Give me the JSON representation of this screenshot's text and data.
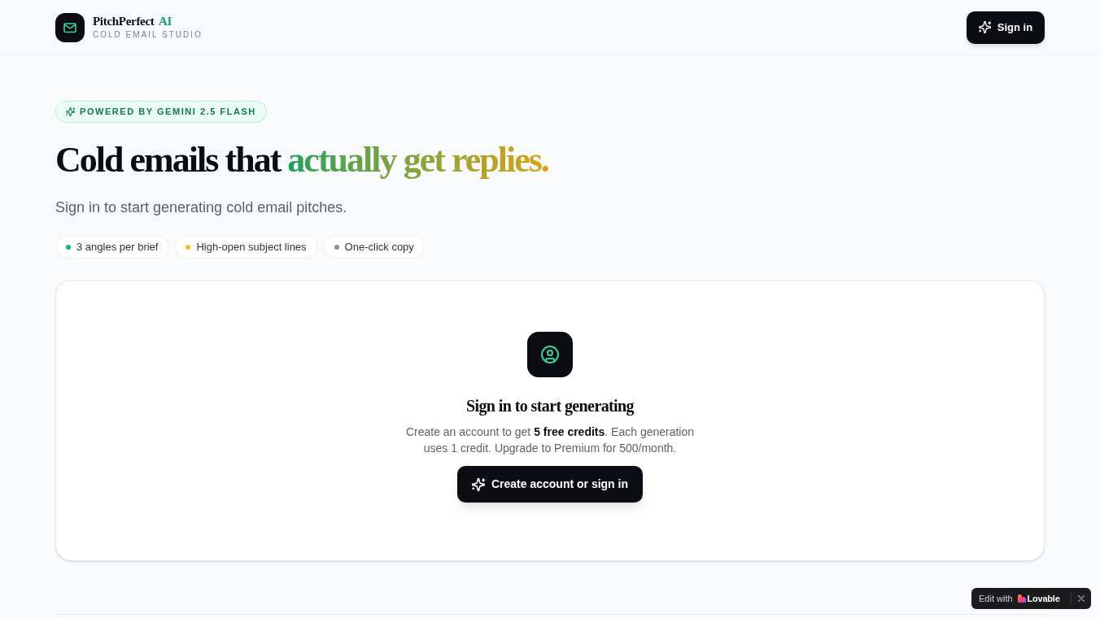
{
  "header": {
    "logo": {
      "name": "PitchPerfect",
      "accent": "AI",
      "tagline": "COLD EMAIL STUDIO"
    },
    "sign_in_button": "Sign in"
  },
  "hero": {
    "badge": "POWERED BY GEMINI 2.5 FLASH",
    "headline": {
      "text": "Cold emails that",
      "highlight": "actually get replies."
    },
    "subtitle": "Sign in to start generating cold email pitches.",
    "features": [
      {
        "label": "3 angles per brief",
        "color": "#10b981"
      },
      {
        "label": "High-open subject lines",
        "color": "#fbbf24"
      },
      {
        "label": "One-click copy",
        "color": "#8a8f98"
      }
    ]
  },
  "sign_in_card": {
    "title": "Sign in to start generating",
    "description": "Create an account to get **5 free credits**. Each generation uses 1 credit. Upgrade to Premium for 500/month.",
    "button": "Create account or sign in"
  },
  "edit_badge": {
    "prefix": "Edit with",
    "brand": "Lovable"
  }
}
